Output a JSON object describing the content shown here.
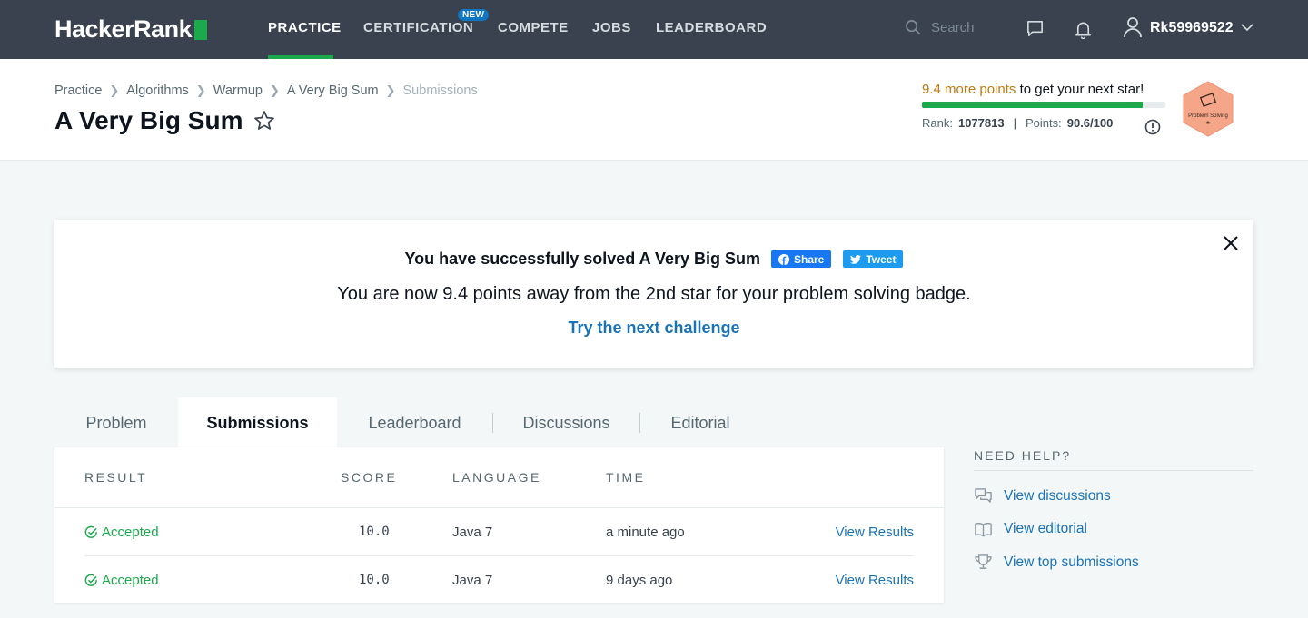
{
  "brand": {
    "name": "HackerRank",
    "accent": "#1ba94c"
  },
  "nav": {
    "items": [
      {
        "label": "PRACTICE",
        "active": true
      },
      {
        "label": "CERTIFICATION",
        "badge": "NEW"
      },
      {
        "label": "COMPETE"
      },
      {
        "label": "JOBS"
      },
      {
        "label": "LEADERBOARD"
      }
    ],
    "search_placeholder": "Search",
    "username": "Rk59969522"
  },
  "breadcrumb": [
    "Practice",
    "Algorithms",
    "Warmup",
    "A Very Big Sum",
    "Submissions"
  ],
  "page_title": "A Very Big Sum",
  "progress": {
    "more_points": "9.4 more points",
    "more_points_suffix": "to get your next star!",
    "fill_fraction": 0.906,
    "rank_label": "Rank:",
    "rank_value": "1077813",
    "points_label": "Points:",
    "points_value": "90.6/100",
    "badge_label": "Problem Solving"
  },
  "success": {
    "headline": "You have successfully solved A Very Big Sum",
    "share_label": "Share",
    "tweet_label": "Tweet",
    "message": "You are now 9.4 points away from the 2nd star for your problem solving badge.",
    "next_link": "Try the next challenge"
  },
  "tabs": [
    "Problem",
    "Submissions",
    "Leaderboard",
    "Discussions",
    "Editorial"
  ],
  "table": {
    "headers": [
      "RESULT",
      "SCORE",
      "LANGUAGE",
      "TIME"
    ],
    "rows": [
      {
        "result": "Accepted",
        "score": "10.0",
        "language": "Java 7",
        "time": "a minute ago",
        "action": "View Results"
      },
      {
        "result": "Accepted",
        "score": "10.0",
        "language": "Java 7",
        "time": "9 days ago",
        "action": "View Results"
      }
    ]
  },
  "help": {
    "title": "NEED HELP?",
    "items": [
      {
        "label": "View discussions",
        "icon": "discussions-icon"
      },
      {
        "label": "View editorial",
        "icon": "book-icon"
      },
      {
        "label": "View top submissions",
        "icon": "trophy-icon"
      }
    ]
  }
}
